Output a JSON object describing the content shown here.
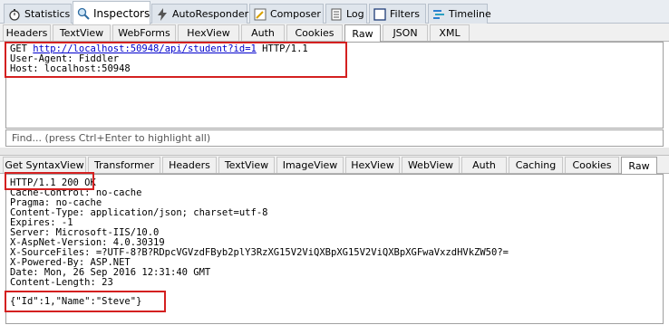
{
  "main_tabs": [
    {
      "label": "Statistics",
      "icon": "stopwatch-icon"
    },
    {
      "label": "Inspectors",
      "icon": "magnifier-icon"
    },
    {
      "label": "AutoResponder",
      "icon": "lightning-icon"
    },
    {
      "label": "Composer",
      "icon": "pencil-icon"
    },
    {
      "label": "Log",
      "icon": "log-icon"
    },
    {
      "label": "Filters",
      "icon": "checkbox-icon"
    },
    {
      "label": "Timeline",
      "icon": "timeline-icon"
    }
  ],
  "active_main_tab": "Inspectors",
  "request": {
    "tabs": [
      "Headers",
      "TextView",
      "WebForms",
      "HexView",
      "Auth",
      "Cookies",
      "Raw",
      "JSON",
      "XML"
    ],
    "active_tab": "Raw",
    "method": "GET",
    "url": "http://localhost:50948/api/student?id=1",
    "protocol": "HTTP/1.1",
    "lines": [
      "User-Agent: Fiddler",
      "Host: localhost:50948"
    ]
  },
  "find_placeholder": "Find... (press Ctrl+Enter to highlight all)",
  "response": {
    "tabs": [
      "Get SyntaxView",
      "Transformer",
      "Headers",
      "TextView",
      "ImageView",
      "HexView",
      "WebView",
      "Auth",
      "Caching",
      "Cookies",
      "Raw"
    ],
    "active_tab": "Raw",
    "status_line": "HTTP/1.1 200 OK",
    "headers": [
      "Cache-Control: no-cache",
      "Pragma: no-cache",
      "Content-Type: application/json; charset=utf-8",
      "Expires: -1",
      "Server: Microsoft-IIS/10.0",
      "X-AspNet-Version: 4.0.30319",
      "X-SourceFiles: =?UTF-8?B?RDpcVGVzdFByb2plY3RzXG15V2ViQXBpXG15V2ViQXBpXGFwaVxzdHVkZW50?=",
      "X-Powered-By: ASP.NET",
      "Date: Mon, 26 Sep 2016 12:31:40 GMT",
      "Content-Length: 23"
    ],
    "body": "{\"Id\":1,\"Name\":\"Steve\"}"
  },
  "colors": {
    "highlight_box": "#d42020",
    "link": "#0000cc"
  }
}
